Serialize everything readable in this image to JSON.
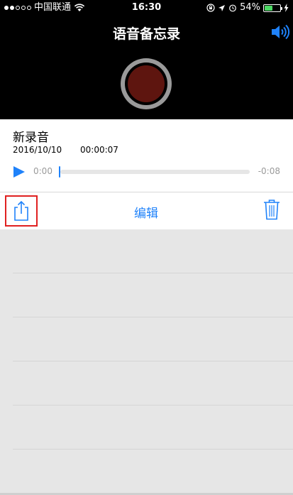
{
  "status_bar": {
    "carrier": "中国联通",
    "time": "16:30",
    "battery": "54%",
    "battery_level": 0.54,
    "signal_bars": 5,
    "signal_filled": 2
  },
  "header": {
    "title": "语音备忘录"
  },
  "recording": {
    "name": "新录音",
    "date": "2016/10/10",
    "duration": "00:00:07",
    "current_time": "0:00",
    "remaining_time": "-0:08",
    "progress": 0
  },
  "toolbar": {
    "edit_label": "编辑"
  },
  "colors": {
    "accent": "#1f82fa",
    "record": "#5e150f",
    "highlight": "#e02020"
  },
  "icons": [
    "wifi-icon",
    "lock-rotation-icon",
    "location-icon",
    "alarm-icon",
    "battery-icon",
    "charging-icon",
    "speaker-icon",
    "record-icon",
    "play-icon",
    "share-icon",
    "trash-icon"
  ]
}
